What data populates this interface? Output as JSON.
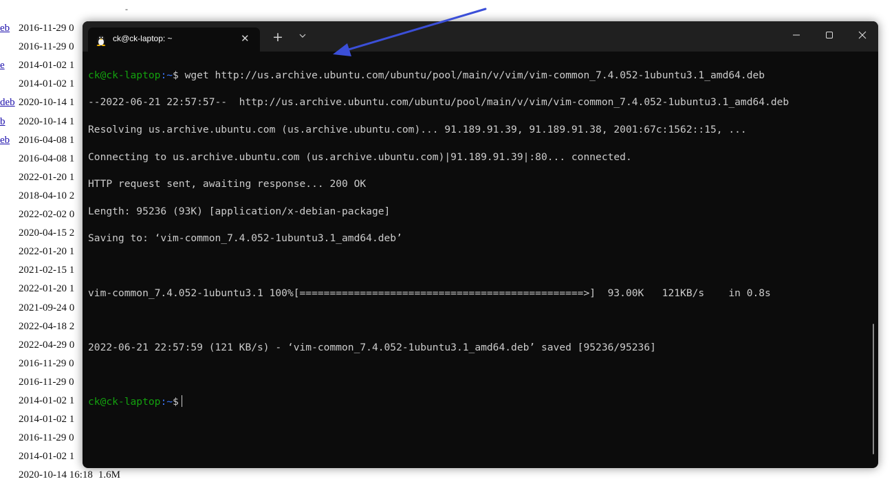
{
  "background_listing": {
    "rows": [
      {
        "link": "eb",
        "date": "2016-11-29 0"
      },
      {
        "link": "",
        "date": "2016-11-29 0"
      },
      {
        "link": "e",
        "date": "2014-01-02 1"
      },
      {
        "link": "",
        "date": "2014-01-02 1"
      },
      {
        "link": "deb",
        "date": "2020-10-14 1"
      },
      {
        "link": "b",
        "date": "2020-10-14 1"
      },
      {
        "link": "eb",
        "date": "2016-04-08 1"
      },
      {
        "link": "",
        "date": "2016-04-08 1"
      },
      {
        "link": "",
        "date": "2022-01-20 1"
      },
      {
        "link": "",
        "date": "2018-04-10 2"
      },
      {
        "link": "",
        "date": "2022-02-02 0"
      },
      {
        "link": "",
        "date": "2020-04-15 2"
      },
      {
        "link": "",
        "date": "2022-01-20 1"
      },
      {
        "link": "",
        "date": "2021-02-15 1"
      },
      {
        "link": "",
        "date": "2022-01-20 1"
      },
      {
        "link": "",
        "date": "2021-09-24 0"
      },
      {
        "link": "",
        "date": "2022-04-18 2"
      },
      {
        "link": "",
        "date": "2022-04-29 0"
      },
      {
        "link": "",
        "date": "2016-11-29 0"
      },
      {
        "link": "",
        "date": "2016-11-29 0"
      },
      {
        "link": "",
        "date": "2014-01-02 1"
      },
      {
        "link": "",
        "date": "2014-01-02 1"
      },
      {
        "link": "",
        "date": "2016-11-29 0"
      },
      {
        "link": "",
        "date": "2014-01-02 1"
      },
      {
        "link": "",
        "date": "2020-10-14 16:18",
        "size": "1.6M"
      }
    ],
    "dash": "-"
  },
  "terminal": {
    "tab_title": "ck@ck-laptop: ~",
    "close_glyph": "✕",
    "new_tab_glyph": "+",
    "prompt_user": "ck@ck-laptop",
    "prompt_path": ":~",
    "prompt_symbol": "$",
    "lines": {
      "command": " wget http://us.archive.ubuntu.com/ubuntu/pool/main/v/vim/vim-common_7.4.052-1ubuntu3.1_amd64.deb",
      "l1": "--2022-06-21 22:57:57--  http://us.archive.ubuntu.com/ubuntu/pool/main/v/vim/vim-common_7.4.052-1ubuntu3.1_amd64.deb",
      "l2": "Resolving us.archive.ubuntu.com (us.archive.ubuntu.com)... 91.189.91.39, 91.189.91.38, 2001:67c:1562::15, ...",
      "l3": "Connecting to us.archive.ubuntu.com (us.archive.ubuntu.com)|91.189.91.39|:80... connected.",
      "l4": "HTTP request sent, awaiting response... 200 OK",
      "l5": "Length: 95236 (93K) [application/x-debian-package]",
      "l6": "Saving to: ‘vim-common_7.4.052-1ubuntu3.1_amd64.deb’",
      "progress": "vim-common_7.4.052-1ubuntu3.1 100%[===============================================>]  93.00K   121KB/s    in 0.8s",
      "saved": "2022-06-21 22:57:59 (121 KB/s) - ‘vim-common_7.4.052-1ubuntu3.1_amd64.deb’ saved [95236/95236]"
    }
  },
  "colors": {
    "terminal_bg": "#0c0c0c",
    "titlebar_bg": "#202020",
    "prompt_user": "#13a10e",
    "prompt_path": "#3b78ff",
    "text": "#cccccc",
    "arrow": "#3b4fd8"
  },
  "icons": {
    "tab_icon": "linux-penguin-icon",
    "dropdown": "chevron-down-icon",
    "minimize": "minimize-icon",
    "maximize": "maximize-icon",
    "close": "close-icon"
  }
}
